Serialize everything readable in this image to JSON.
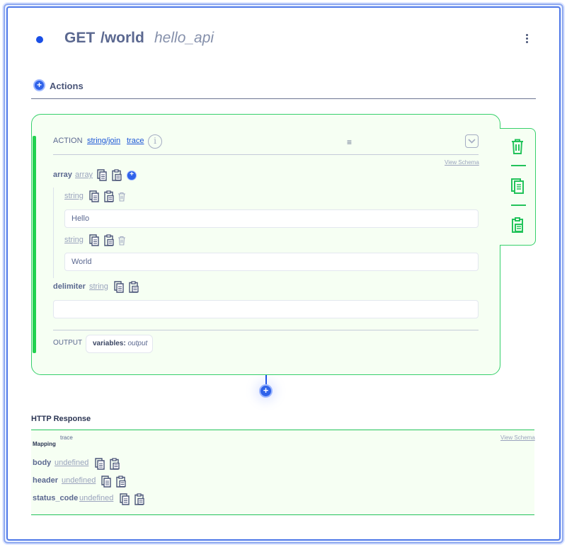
{
  "header": {
    "method": "GET",
    "path": "/world",
    "api_name": "hello_api"
  },
  "actions": {
    "label": "Actions",
    "add_symbol": "+"
  },
  "action_card": {
    "action_label": "ACTION",
    "function_link": "string/join",
    "trace_link": "trace",
    "info_symbol": "i",
    "drag_symbol": "≡",
    "view_schema": "View Schema",
    "array": {
      "label": "array",
      "type": "array",
      "items": [
        {
          "type": "string",
          "value": "Hello"
        },
        {
          "type": "string",
          "value": "World"
        }
      ]
    },
    "delimiter": {
      "label": "delimiter",
      "type": "string",
      "value": ""
    },
    "output": {
      "label": "OUTPUT",
      "variables_key": "variables:",
      "variables_value": "output"
    }
  },
  "http_response": {
    "title": "HTTP Response",
    "mapping_label": "Mapping",
    "trace_label": "trace",
    "view_schema": "View Schema",
    "fields": [
      {
        "name": "body",
        "value": "undefined"
      },
      {
        "name": "header",
        "value": "undefined"
      },
      {
        "name": "status_code",
        "value": "undefined"
      }
    ]
  },
  "colors": {
    "accent_blue": "#2f62e9",
    "success_green": "#22d14f",
    "card_bg": "#f6fff3"
  },
  "icons": {
    "copy": "copy-icon",
    "paste": "paste-icon",
    "trash": "trash-icon",
    "info": "info-icon",
    "collapse": "chevron-down-icon",
    "more": "more-vertical-icon"
  }
}
